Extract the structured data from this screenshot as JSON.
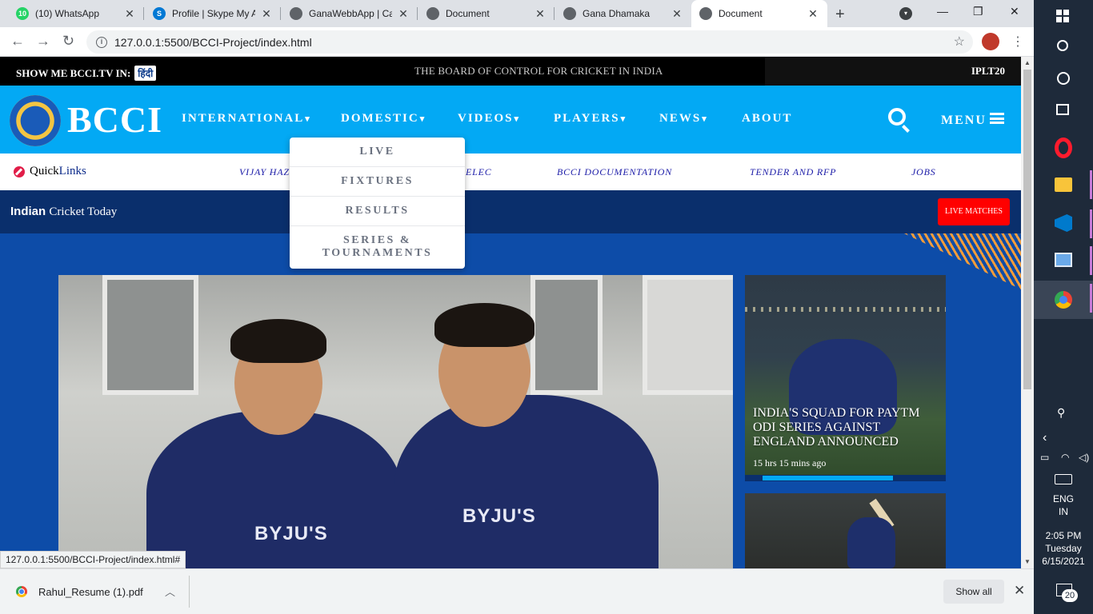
{
  "browser": {
    "tabs": [
      {
        "title": "(10) WhatsApp",
        "icon": "whatsapp-icon",
        "badge": "10"
      },
      {
        "title": "Profile | Skype My Account",
        "icon": "skype-icon"
      },
      {
        "title": "GanaWebbApp | Cat",
        "icon": "globe-icon"
      },
      {
        "title": "Document",
        "icon": "globe-icon"
      },
      {
        "title": "Gana Dhamaka",
        "icon": "globe-icon"
      },
      {
        "title": "Document",
        "icon": "globe-icon",
        "active": true
      }
    ],
    "url": "127.0.0.1:5500/BCCI-Project/index.html",
    "status_url": "127.0.0.1:5500/BCCI-Project/index.html#"
  },
  "site": {
    "topbar": {
      "show_me": "SHOW ME BCCI.TV IN:",
      "hindi": "हिंदी",
      "board": "THE BOARD OF CONTROL FOR CRICKET IN INDIA",
      "ipl": "IPLT20"
    },
    "logo": "BCCI",
    "nav": [
      {
        "label": "INTERNATIONAL",
        "dropdown": true
      },
      {
        "label": "DOMESTIC",
        "dropdown": true
      },
      {
        "label": "VIDEOS",
        "dropdown": true
      },
      {
        "label": "PLAYERS",
        "dropdown": true
      },
      {
        "label": "NEWS",
        "dropdown": true
      },
      {
        "label": "ABOUT",
        "dropdown": false
      }
    ],
    "menu_label": "MENU",
    "domestic_dropdown": [
      "LIVE",
      "FIXTURES",
      "RESULTS",
      "SERIES & TOURNAMENTS"
    ],
    "quicklinks": {
      "prefix": "Quick",
      "suffix": "Links",
      "links": [
        "VIJAY HAZ",
        "ELEC",
        "BCCI DOCUMENTATION",
        "TENDER AND RFP",
        "JOBS"
      ]
    },
    "today": {
      "bold": "Indian",
      "rest": "Cricket Today",
      "live_button": "LIVE MATCHES"
    },
    "hero": {
      "jersey_text": "BYJU'S"
    },
    "cards": [
      {
        "title": "INDIA'S SQUAD FOR PAYTM ODI SERIES AGAINST ENGLAND ANNOUNCED",
        "time": "15 hrs 15 mins ago",
        "progress": 0.81
      }
    ]
  },
  "downloads": {
    "file": "Rahul_Resume (1).pdf",
    "show_all": "Show all"
  },
  "taskbar": {
    "lang_line1": "ENG",
    "lang_line2": "IN",
    "time": "2:05 PM",
    "day": "Tuesday",
    "date": "6/15/2021",
    "notifications": "20"
  }
}
